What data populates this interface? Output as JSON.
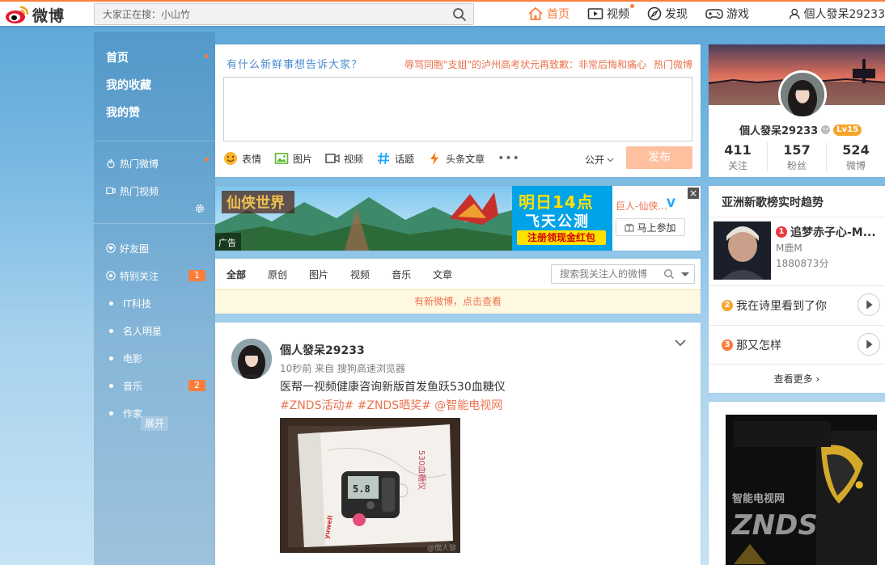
{
  "colors": {
    "accent": "#fa7d3c",
    "link_orange": "#eb7350",
    "sidebar_text": "#ffffff",
    "verified_blue": "#1fa7ff"
  },
  "topbar": {
    "logo_text": "微博",
    "search_placeholder": "大家正在搜：小山竹",
    "nav": [
      {
        "label": "首页",
        "icon": "home-icon"
      },
      {
        "label": "视频",
        "icon": "video-icon"
      },
      {
        "label": "发现",
        "icon": "compass-icon"
      },
      {
        "label": "游戏",
        "icon": "gamepad-icon"
      }
    ],
    "user": "個人發呆29233"
  },
  "sidebar": {
    "main": [
      "首页",
      "我的收藏",
      "我的赞"
    ],
    "group1": [
      {
        "label": "热门微博",
        "icon": "fire-icon"
      },
      {
        "label": "热门视频",
        "icon": "video-icon"
      }
    ],
    "group2": [
      {
        "label": "好友圈",
        "icon": "heart-circle-icon",
        "badge": ""
      },
      {
        "label": "特别关注",
        "icon": "eye-icon",
        "badge": "1"
      },
      {
        "label": "IT科技",
        "badge": ""
      },
      {
        "label": "名人明星",
        "badge": ""
      },
      {
        "label": "电影",
        "badge": ""
      },
      {
        "label": "音乐",
        "badge": "2"
      },
      {
        "label": "作家",
        "badge": ""
      }
    ],
    "expand": "展开"
  },
  "composer": {
    "prompt": "有什么新鲜事想告诉大家？",
    "hot_topic": "辱骂同胞\"支姐\"的泸州高考状元再致歉：非常后悔和痛心",
    "hot_link": "热门微博",
    "tools": [
      "表情",
      "图片",
      "视频",
      "话题",
      "头条文章"
    ],
    "more": "•••",
    "visibility": "公开",
    "send": "发布"
  },
  "ad": {
    "tag": "广告",
    "promo_line1": "明日14点",
    "promo_line2": "飞天公测",
    "promo_line3": "注册领现金红包",
    "advertiser": "巨人-仙侠...",
    "join": "马上参加",
    "close": "×"
  },
  "filter": {
    "tabs": [
      "全部",
      "原创",
      "图片",
      "视频",
      "音乐",
      "文章"
    ],
    "search_placeholder": "搜索我关注人的微博",
    "new_notice": "有新微博，点击查看"
  },
  "post": {
    "author": "個人發呆29233",
    "meta": "10秒前 来自 搜狗高速浏览器",
    "text": "医帮一视频健康咨询新版首发鱼跃530血糖仪",
    "tags": "#ZNDS活动# #ZNDS晒奖# @智能电视网",
    "image_watermark": "@個人發"
  },
  "profile": {
    "name": "個人發呆29233",
    "level": "Lv15",
    "stats": [
      {
        "num": "411",
        "label": "关注"
      },
      {
        "num": "157",
        "label": "粉丝"
      },
      {
        "num": "524",
        "label": "微博"
      }
    ]
  },
  "trends": {
    "title": "亚洲新歌榜实时趋势",
    "top": {
      "rank": "1",
      "title": "追梦赤子心-M...",
      "artist": "M鹿M",
      "score": "1880873分"
    },
    "items": [
      {
        "rank": "2",
        "title": "我在诗里看到了你"
      },
      {
        "rank": "3",
        "title": "那又怎样"
      }
    ],
    "more": "查看更多"
  }
}
